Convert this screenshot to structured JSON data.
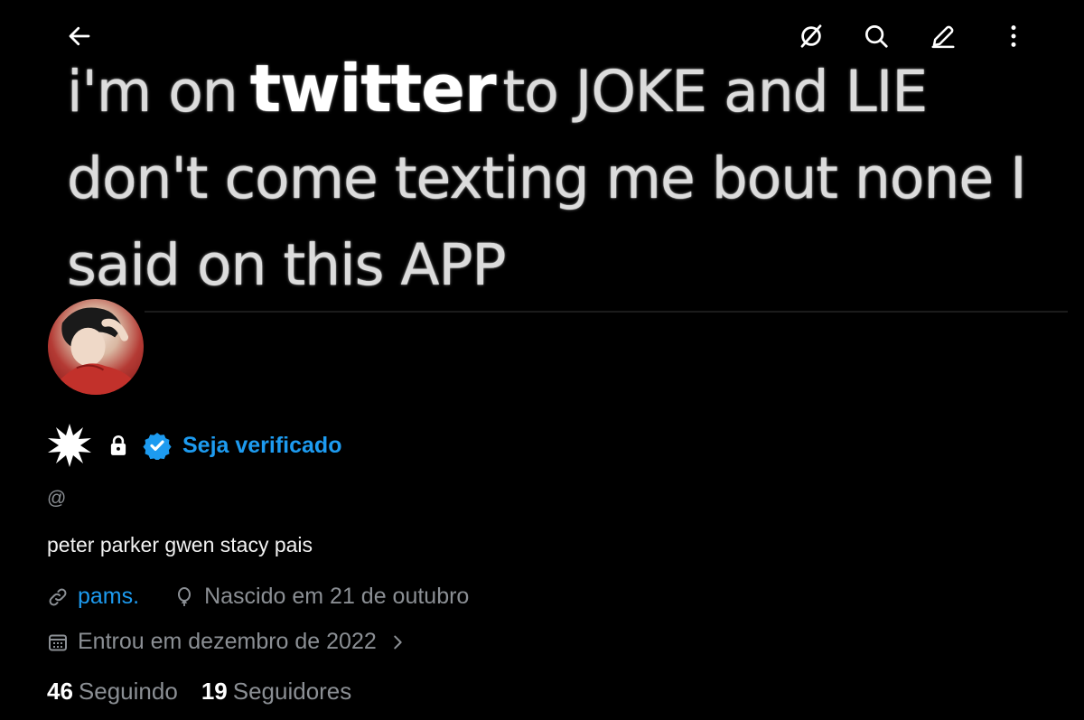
{
  "banner": {
    "line1_a": "i'm on",
    "line1_big": "twitter",
    "line1_b": "to JOKE and LIE",
    "line2": "don't come texting me bout none I",
    "line3": "said on this APP"
  },
  "topbar": {
    "icons": [
      "back-arrow-icon",
      "grok-icon",
      "search-icon",
      "edit-icon",
      "more-icon"
    ]
  },
  "profile": {
    "verify_label": "Seja verificado",
    "handle": "@",
    "bio": "peter parker gwen stacy pais",
    "link_text": "pams.",
    "birthday": "Nascido em 21 de outubro",
    "joined": "Entrou em dezembro de 2022",
    "following_count": "46",
    "following_label": "Seguindo",
    "followers_count": "19",
    "followers_label": "Seguidores"
  },
  "colors": {
    "accent": "#1d9bf0",
    "secondary_text": "#8b8f94",
    "background": "#000000"
  }
}
